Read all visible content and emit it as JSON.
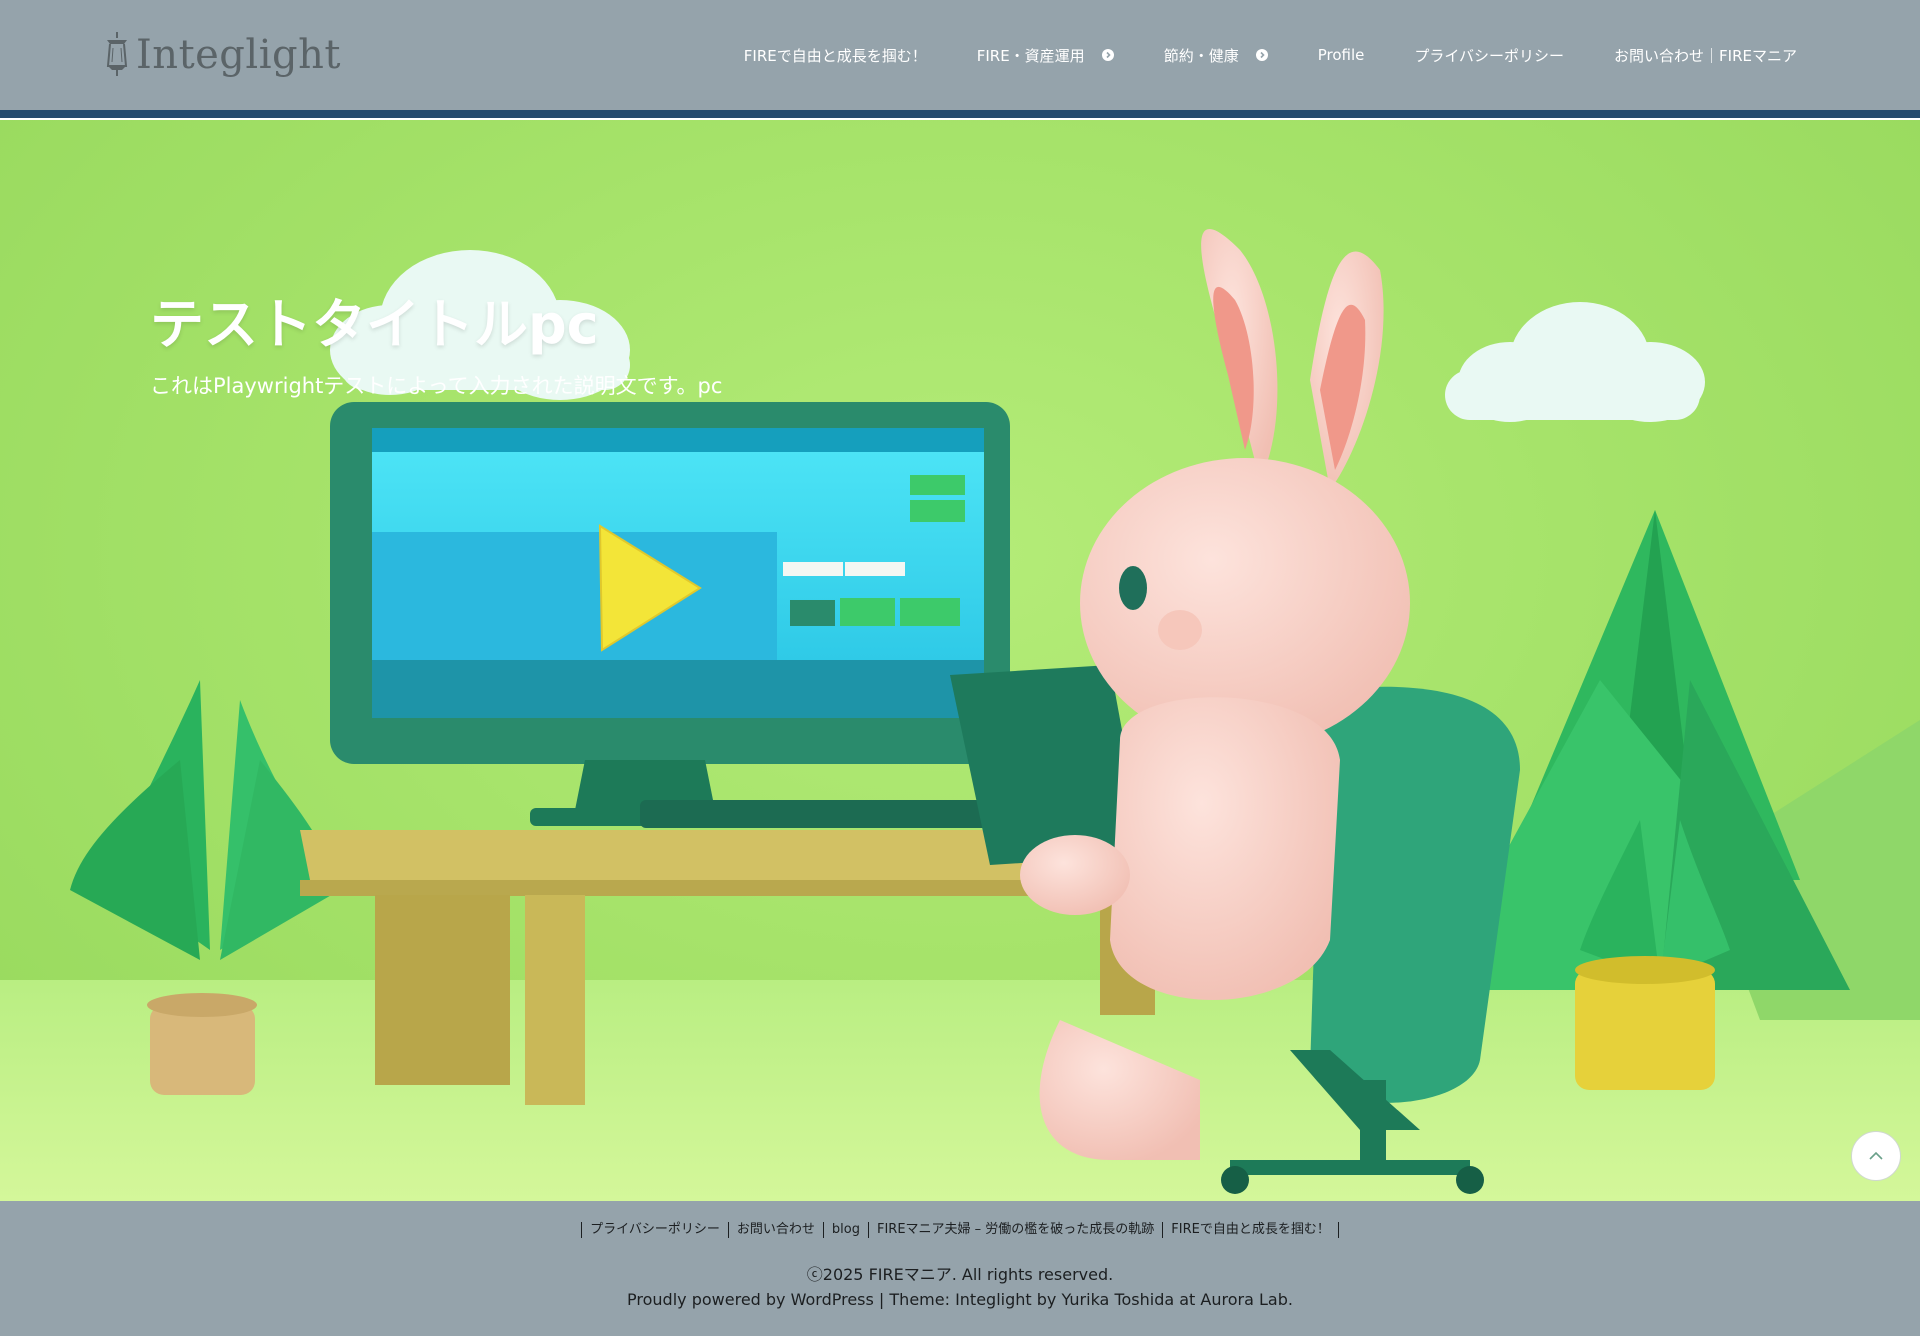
{
  "header": {
    "logo_text": "Integlight",
    "nav": [
      {
        "label": "FIREで自由と成長を掴む！",
        "has_submenu": false
      },
      {
        "label": "FIRE・資産運用",
        "has_submenu": true
      },
      {
        "label": "節約・健康",
        "has_submenu": true
      },
      {
        "label": "Profile",
        "has_submenu": false
      },
      {
        "label": "プライバシーポリシー",
        "has_submenu": false
      },
      {
        "label": "お問い合わせ｜FIREマニア",
        "has_submenu": false
      }
    ]
  },
  "hero": {
    "title": "テストタイトルpc",
    "description": "これはPlaywrightテストによって入力された説明文です。pc",
    "image_description": "3D illustration of a pink rabbit sitting in a green chair at a desk, using a computer with a video player on screen, surrounded by trees, plants and clouds"
  },
  "footer": {
    "links": [
      "プライバシーポリシー",
      "お問い合わせ",
      "blog",
      "FIREマニア夫婦 – 労働の檻を破った成長の軌跡",
      "FIREで自由と成長を掴む！"
    ],
    "copyright": "ⓒ2025 FIREマニア. All rights reserved.",
    "powered": "Proudly powered by WordPress | Theme: Integlight by Yurika Toshida at Aurora Lab."
  },
  "colors": {
    "header_bg": "#95a3ab",
    "accent_stripe": "#254a6e",
    "hero_green": "#a6e36a"
  }
}
